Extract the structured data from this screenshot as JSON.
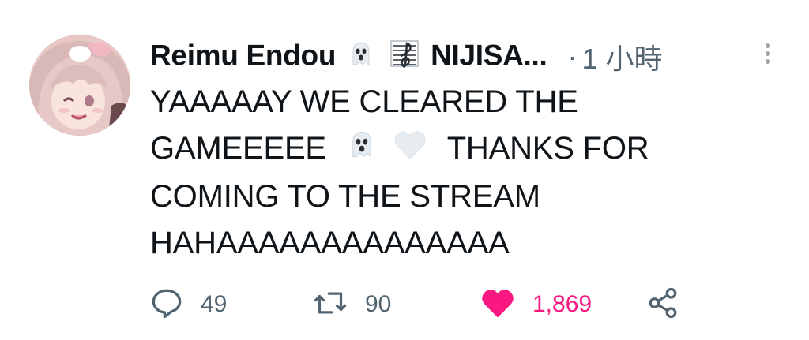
{
  "tweet": {
    "author": {
      "name_text": "Reimu Endou",
      "name_suffix": "NIJISA...",
      "badges": [
        "ghost-emoji",
        "musical-score-emoji"
      ]
    },
    "separator": "·",
    "timestamp": "1 小時",
    "text_lines": [
      "YAAAAAY WE CLEARED THE",
      "GAMEEEEE",
      "THANKS FOR",
      "COMING TO THE STREAM",
      "HAHAAAAAAAAAAAAAA"
    ],
    "inline_emojis": [
      "ghost-emoji",
      "white-heart-emoji"
    ],
    "actions": {
      "reply_count": "49",
      "retweet_count": "90",
      "like_count": "1,869",
      "liked": true
    }
  },
  "colors": {
    "text_primary": "#0f1419",
    "text_secondary": "#536471",
    "like_active": "#f91880",
    "divider": "#eff3f4"
  },
  "icons": [
    "more-vertical-icon",
    "reply-icon",
    "retweet-icon",
    "heart-filled-icon",
    "share-icon"
  ]
}
